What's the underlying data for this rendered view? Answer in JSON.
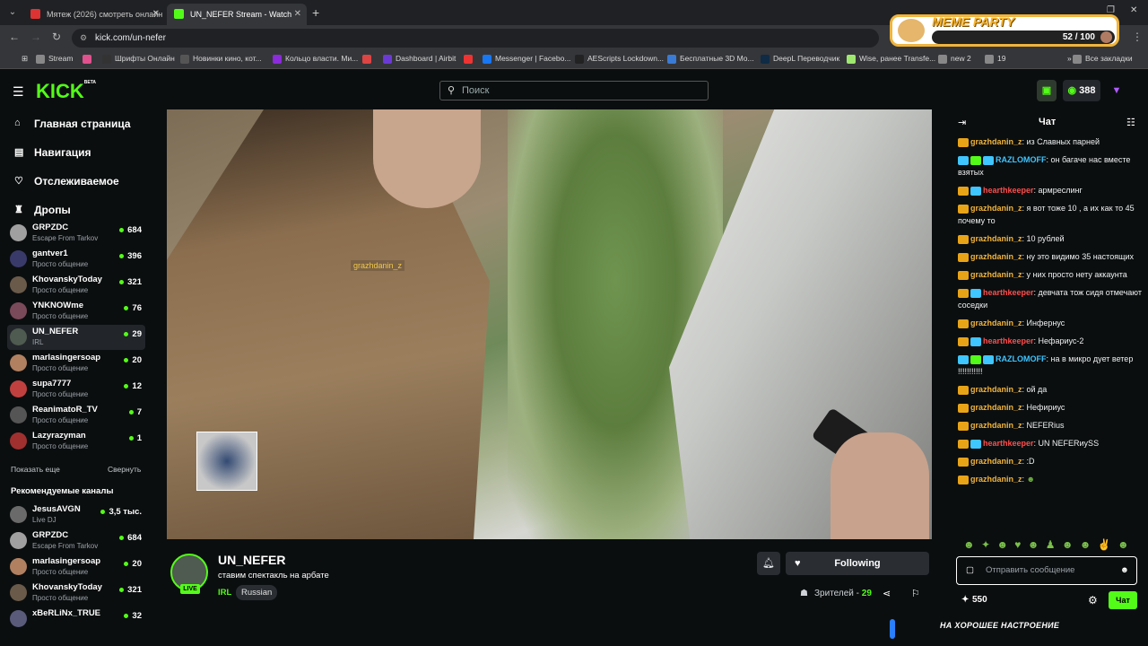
{
  "browser": {
    "tabs": [
      {
        "title": "Мятеж (2026) смотреть онлайн",
        "favicon_color": "#d33"
      },
      {
        "title": "UN_NEFER Stream - Watch",
        "favicon_color": "#53fc18"
      }
    ],
    "url": "kick.com/un-nefer",
    "bookmarks": [
      {
        "label": "Stream",
        "color": "#888"
      },
      {
        "label": "",
        "color": "#e0518d"
      },
      {
        "label": "Шрифты Онлайн",
        "color": "#333"
      },
      {
        "label": "Новинки кино, кот...",
        "color": "#555"
      },
      {
        "label": "Кольцо власти. Ми...",
        "color": "#8b2bdb"
      },
      {
        "label": "",
        "color": "#d44"
      },
      {
        "label": "Dashboard | Airbit",
        "color": "#6b3ad6"
      },
      {
        "label": "",
        "color": "#e33"
      },
      {
        "label": "Messenger | Facebo...",
        "color": "#1877f2"
      },
      {
        "label": "AEScripts Lockdown...",
        "color": "#222"
      },
      {
        "label": "Бесплатные 3D Mo...",
        "color": "#3a7bd5"
      },
      {
        "label": "DeepL Переводчик",
        "color": "#0f2b46"
      },
      {
        "label": "Wise, ранее Transfe...",
        "color": "#9fe870"
      },
      {
        "label": "new 2",
        "color": "#888"
      },
      {
        "label": "19",
        "color": "#888"
      },
      {
        "label": "Все закладки",
        "color": "#888"
      }
    ]
  },
  "meme_party": {
    "title": "MEME PARTY",
    "count": "52 / 100"
  },
  "header": {
    "logo": "KICK",
    "logo_beta": "BETA",
    "search_placeholder": "Поиск",
    "points": "388"
  },
  "nav": {
    "items": [
      {
        "label": "Главная страница",
        "icon": "⌂"
      },
      {
        "label": "Навигация",
        "icon": "▤"
      },
      {
        "label": "Отслеживаемое",
        "icon": "♡"
      },
      {
        "label": "Дропы",
        "icon": "♜"
      }
    ],
    "following": [
      {
        "name": "GRPZDC",
        "category": "Escape From Tarkov",
        "viewers": "684",
        "color": "#a0a0a0"
      },
      {
        "name": "gantver1",
        "category": "Просто общение",
        "viewers": "396",
        "color": "#3a3a6a"
      },
      {
        "name": "KhovanskyToday",
        "category": "Просто общение",
        "viewers": "321",
        "color": "#6a5a4a"
      },
      {
        "name": "YNKNOWme",
        "category": "Просто общение",
        "viewers": "76",
        "color": "#7a4a5a"
      },
      {
        "name": "UN_NEFER",
        "category": "IRL",
        "viewers": "29",
        "color": "#4f5a50"
      },
      {
        "name": "marlasingersoap",
        "category": "Просто общение",
        "viewers": "20",
        "color": "#b08060"
      },
      {
        "name": "supa7777",
        "category": "Просто общение",
        "viewers": "12",
        "color": "#c04040"
      },
      {
        "name": "ReanimatoR_TV",
        "category": "Просто общение",
        "viewers": "7",
        "color": "#555"
      },
      {
        "name": "Lazyrazyman",
        "category": "Просто общение",
        "viewers": "1",
        "color": "#a03030"
      }
    ],
    "show_more": "Показать еще",
    "collapse": "Свернуть",
    "recommended_title": "Рекомендуемые каналы",
    "recommended": [
      {
        "name": "JesusAVGN",
        "category": "Live DJ",
        "viewers": "3,5 тыс.",
        "color": "#6a6a6a"
      },
      {
        "name": "GRPZDC",
        "category": "Escape From Tarkov",
        "viewers": "684",
        "color": "#a0a0a0"
      },
      {
        "name": "marlasingersoap",
        "category": "Просто общение",
        "viewers": "20",
        "color": "#b08060"
      },
      {
        "name": "KhovanskyToday",
        "category": "Просто общение",
        "viewers": "321",
        "color": "#6a5a4a"
      },
      {
        "name": "xBeRLiNx_TRUE",
        "category": "",
        "viewers": "32",
        "color": "#5a5a7a"
      }
    ]
  },
  "video": {
    "overlay_tag": "grazhdanin_z"
  },
  "stream": {
    "live_badge": "LIVE",
    "name": "UN_NEFER",
    "title": "ставим спектакль на арбате",
    "category": "IRL",
    "language": "Russian",
    "follow_label": "Following",
    "viewers_label": "Зрителей -",
    "viewers": "29"
  },
  "chat": {
    "title": "Чат",
    "messages": [
      {
        "user": "grazhdanin_z",
        "text": ": из Славных парней",
        "color": "#f0b43c",
        "badges": [
          "#e8a317"
        ]
      },
      {
        "user": "RAZLOMOFF",
        "text": ": он багаче нас вместе взятых",
        "color": "#3fc5ff",
        "badges": [
          "#3fc5ff",
          "#53fc18",
          "#3fc5ff"
        ]
      },
      {
        "user": "hearthkeeper",
        "text": ": армреслинг",
        "color": "#ff4d4d",
        "badges": [
          "#e8a317",
          "#3fc5ff"
        ]
      },
      {
        "user": "grazhdanin_z",
        "text": ": я вот тоже 10 , а их как то 45 почему то",
        "color": "#f0b43c",
        "badges": [
          "#e8a317"
        ]
      },
      {
        "user": "grazhdanin_z",
        "text": ": 10 рублей",
        "color": "#f0b43c",
        "badges": [
          "#e8a317"
        ]
      },
      {
        "user": "grazhdanin_z",
        "text": ": ну это видимо 35 настоящих",
        "color": "#f0b43c",
        "badges": [
          "#e8a317"
        ]
      },
      {
        "user": "grazhdanin_z",
        "text": ": у них просто нету аккаунта",
        "color": "#f0b43c",
        "badges": [
          "#e8a317"
        ]
      },
      {
        "user": "hearthkeeper",
        "text": ": девчата тож сидя отмечают соседки",
        "color": "#ff4d4d",
        "badges": [
          "#e8a317",
          "#3fc5ff"
        ]
      },
      {
        "user": "grazhdanin_z",
        "text": ": Инфернус",
        "color": "#f0b43c",
        "badges": [
          "#e8a317"
        ]
      },
      {
        "user": "hearthkeeper",
        "text": ": Нефариус-2",
        "color": "#ff4d4d",
        "badges": [
          "#e8a317",
          "#3fc5ff"
        ]
      },
      {
        "user": "RAZLOMOFF",
        "text": ": на в микро дует ветер !!!!!!!!!!!",
        "color": "#3fc5ff",
        "badges": [
          "#3fc5ff",
          "#53fc18",
          "#3fc5ff"
        ]
      },
      {
        "user": "grazhdanin_z",
        "text": ": ой да",
        "color": "#f0b43c",
        "badges": [
          "#e8a317"
        ]
      },
      {
        "user": "grazhdanin_z",
        "text": ": Нефириус",
        "color": "#f0b43c",
        "badges": [
          "#e8a317"
        ]
      },
      {
        "user": "grazhdanin_z",
        "text": ": NEFERius",
        "color": "#f0b43c",
        "badges": [
          "#e8a317"
        ]
      },
      {
        "user": "hearthkeeper",
        "text": ": UN NEFERиуSS",
        "color": "#ff4d4d",
        "badges": [
          "#e8a317",
          "#3fc5ff"
        ]
      },
      {
        "user": "grazhdanin_z",
        "text": ": :D",
        "color": "#f0b43c",
        "badges": [
          "#e8a317"
        ]
      },
      {
        "user": "grazhdanin_z",
        "text": ":",
        "color": "#f0b43c",
        "badges": [
          "#e8a317"
        ]
      }
    ],
    "input_placeholder": "Отправить сообщение",
    "points": "550",
    "send_label": "Чат"
  },
  "bottom_overlay": "НА ХОРОШЕЕ НАСТРОЕНИЕ",
  "colors": {
    "accent": "#53fc18",
    "background": "#0b0e0f"
  }
}
